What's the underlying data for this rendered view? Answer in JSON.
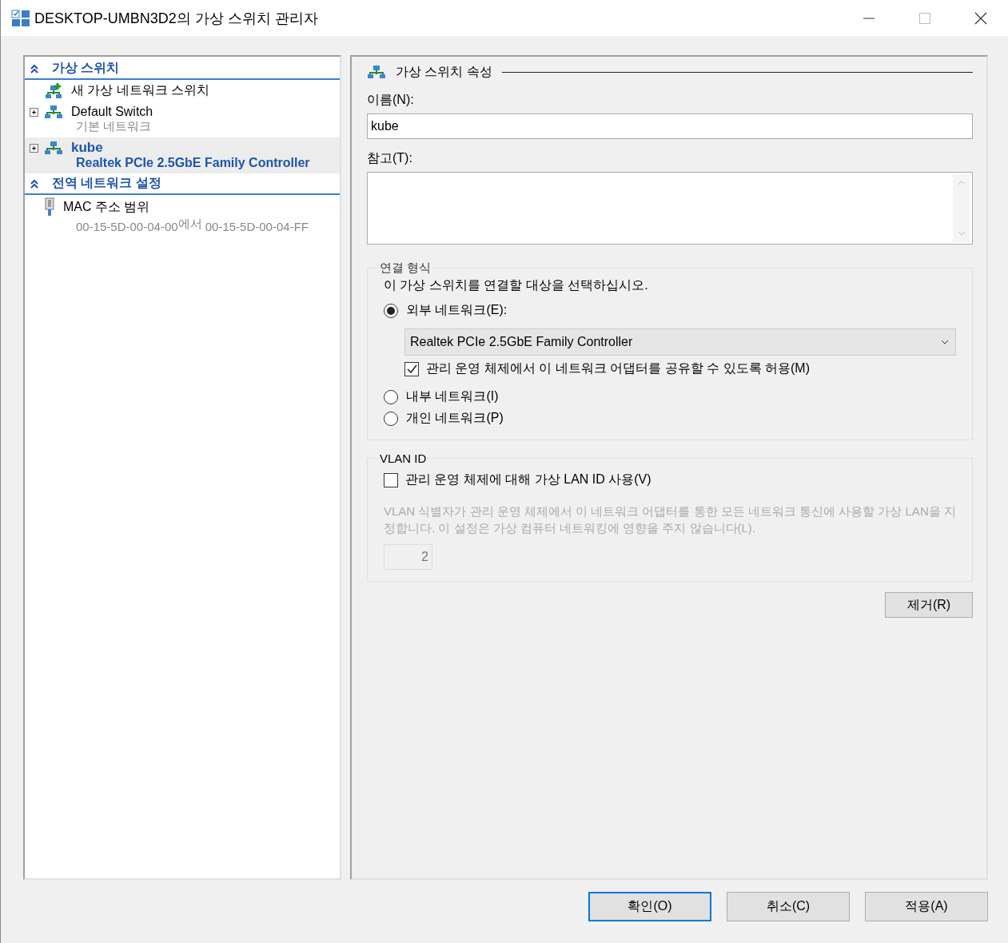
{
  "window": {
    "title": "DESKTOP-UMBN3D2의 가상 스위치 관리자"
  },
  "sidebar": {
    "sections": [
      {
        "title": "가상 스위치",
        "expanded": true,
        "items": [
          {
            "kind": "new",
            "label": "새 가상 네트워크 스위치",
            "selected": false
          },
          {
            "kind": "switch",
            "label": "Default Switch",
            "sublabel": "기본 네트워크",
            "selected": false
          },
          {
            "kind": "switch",
            "label": "kube",
            "sublabel": "Realtek PCIe 2.5GbE Family Controller",
            "selected": true
          }
        ]
      },
      {
        "title": "전역 네트워크 설정",
        "expanded": true,
        "items": [
          {
            "kind": "mac",
            "label": "MAC 주소 범위",
            "sublabel_parts": [
              "00-15-5D-00-04-00",
              "에서",
              "00-15-5D-00-04-FF"
            ],
            "selected": false
          }
        ]
      }
    ]
  },
  "properties": {
    "title": "가상 스위치 속성",
    "name_label": "이름(N):",
    "name_value": "kube",
    "notes_label": "참고(T):",
    "connection": {
      "legend": "연결 형식",
      "instruction": "이 가상 스위치를 연결할 대상을 선택하십시오.",
      "options": [
        {
          "label": "외부 네트워크(E):",
          "selected": true
        },
        {
          "label": "내부 네트워크(I)",
          "selected": false
        },
        {
          "label": "개인 네트워크(P)",
          "selected": false
        }
      ],
      "adapter": "Realtek PCIe 2.5GbE Family Controller",
      "share": {
        "label": "관리 운영 체제에서 이 네트워크 어댑터를 공유할 수 있도록 허용(M)",
        "checked": true
      }
    },
    "vlan": {
      "legend": "VLAN ID",
      "checkbox": {
        "label": "관리 운영 체제에 대해 가상 LAN ID 사용(V)",
        "checked": false
      },
      "description": "VLAN 식별자가 관리 운영 체제에서 이 네트워크 어댑터를 통한 모든 네트워크 통신에 사용할 가상 LAN을 지정합니다. 이 설정은 가상 컴퓨터 네트워킹에 영향을 주지 않습니다(L).",
      "id_value": "2"
    },
    "remove_button": "제거(R)"
  },
  "buttons": [
    {
      "label": "확인(O)",
      "default": true
    },
    {
      "label": "취소(C)",
      "default": false
    },
    {
      "label": "적용(A)",
      "default": false
    }
  ]
}
